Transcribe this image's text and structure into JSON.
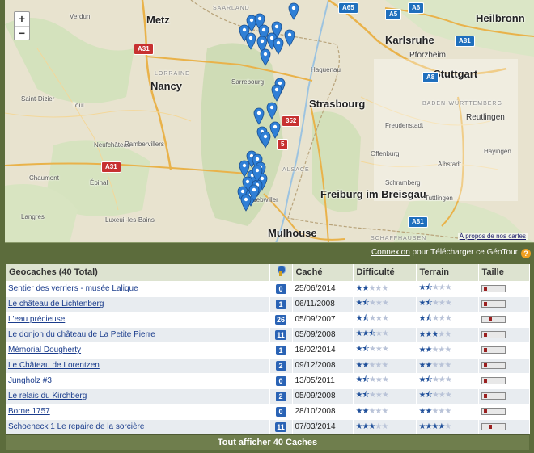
{
  "map": {
    "zoom_in": "+",
    "zoom_out": "−",
    "about_link": "À propos de nos cartes",
    "cities": [
      {
        "name": "Metz",
        "cls": "big"
      },
      {
        "name": "Nancy",
        "cls": "big"
      },
      {
        "name": "Strasbourg",
        "cls": "big"
      },
      {
        "name": "Karlsruhe",
        "cls": "big"
      },
      {
        "name": "Stuttgart",
        "cls": "big"
      },
      {
        "name": "Freiburg im Breisgau",
        "cls": "big"
      },
      {
        "name": "Mulhouse",
        "cls": "big"
      },
      {
        "name": "Heilbronn",
        "cls": "big"
      },
      {
        "name": "Pforzheim",
        "cls": "mid"
      },
      {
        "name": "Reutlingen",
        "cls": "mid"
      },
      {
        "name": "Verdun",
        "cls": "sm"
      },
      {
        "name": "Saint-Dizier",
        "cls": "sm"
      },
      {
        "name": "Neufchâteau",
        "cls": "sm"
      },
      {
        "name": "Chaumont",
        "cls": "sm"
      },
      {
        "name": "Langres",
        "cls": "sm"
      },
      {
        "name": "Épinal",
        "cls": "sm"
      },
      {
        "name": "Rambervillers",
        "cls": "sm"
      },
      {
        "name": "Luxeuil-les-Bains",
        "cls": "sm"
      },
      {
        "name": "Sarrebourg",
        "cls": "sm"
      },
      {
        "name": "Haguenau",
        "cls": "sm"
      },
      {
        "name": "Freudenstadt",
        "cls": "sm"
      },
      {
        "name": "Offenburg",
        "cls": "sm"
      },
      {
        "name": "Schramberg",
        "cls": "sm"
      },
      {
        "name": "Albstadt",
        "cls": "sm"
      },
      {
        "name": "Tuttlingen",
        "cls": "sm"
      },
      {
        "name": "Hayingen",
        "cls": "sm"
      },
      {
        "name": "Guebwiller",
        "cls": "sm"
      },
      {
        "name": "Toul",
        "cls": "sm"
      },
      {
        "name": "LORRAINE",
        "cls": "reg"
      },
      {
        "name": "BADEN-WÜRTTEMBERG",
        "cls": "reg"
      },
      {
        "name": "SAARLAND",
        "cls": "reg"
      },
      {
        "name": "SCHAFFHAUSEN",
        "cls": "reg"
      },
      {
        "name": "ALSACE",
        "cls": "reg"
      }
    ],
    "shields": [
      {
        "label": "A65",
        "color": "blue"
      },
      {
        "label": "A5",
        "color": "blue"
      },
      {
        "label": "A6",
        "color": "blue"
      },
      {
        "label": "A81",
        "color": "blue"
      },
      {
        "label": "A8",
        "color": "blue"
      },
      {
        "label": "A31",
        "color": "red"
      },
      {
        "label": "A31",
        "color": "red"
      },
      {
        "label": "A81",
        "color": "blue"
      },
      {
        "label": "352",
        "color": "red"
      },
      {
        "label": "5",
        "color": "red"
      }
    ]
  },
  "subbar": {
    "connexion": "Connexion",
    "text": " pour Télécharger ce GéoTour",
    "help": "?"
  },
  "table": {
    "headers": {
      "name": "Geocaches (40 Total)",
      "placed": "Caché",
      "difficulty": "Difficulté",
      "terrain": "Terrain",
      "size": "Taille"
    },
    "rows": [
      {
        "name": "Sentier des verriers - musée Lalique",
        "fav": "0",
        "date": "25/06/2014",
        "diff": 2,
        "terr": 1.5,
        "size": 1
      },
      {
        "name": "Le château de Lichtenberg",
        "fav": "1",
        "date": "06/11/2008",
        "diff": 1.5,
        "terr": 1.5,
        "size": 1
      },
      {
        "name": "L'eau précieuse",
        "fav": "26",
        "date": "05/09/2007",
        "diff": 1.5,
        "terr": 1.5,
        "size": 2
      },
      {
        "name": "Le donjon du château de La Petite Pierre",
        "fav": "11",
        "date": "05/09/2008",
        "diff": 2.5,
        "terr": 3,
        "size": 1
      },
      {
        "name": "Mémorial Dougherty",
        "fav": "1",
        "date": "18/02/2014",
        "diff": 1.5,
        "terr": 2,
        "size": 1
      },
      {
        "name": "Le Château de Lorentzen",
        "fav": "2",
        "date": "09/12/2008",
        "diff": 2,
        "terr": 2,
        "size": 1
      },
      {
        "name": "Jungholz #3",
        "fav": "0",
        "date": "13/05/2011",
        "diff": 1.5,
        "terr": 1.5,
        "size": 1
      },
      {
        "name": "Le relais du Kirchberg",
        "fav": "2",
        "date": "05/09/2008",
        "diff": 1.5,
        "terr": 1.5,
        "size": 1
      },
      {
        "name": "Borne 1757",
        "fav": "0",
        "date": "28/10/2008",
        "diff": 2,
        "terr": 2,
        "size": 1
      },
      {
        "name": "Schoeneck 1 Le repaire de la sorcière",
        "fav": "11",
        "date": "07/03/2014",
        "diff": 3,
        "terr": 4,
        "size": 2
      }
    ],
    "show_all": "Tout afficher 40 Caches"
  },
  "colors": {
    "frame": "#5c6c3c",
    "pin": "#2f7fd6",
    "link": "#1a3c8c",
    "footer": "#6f7e4d"
  }
}
